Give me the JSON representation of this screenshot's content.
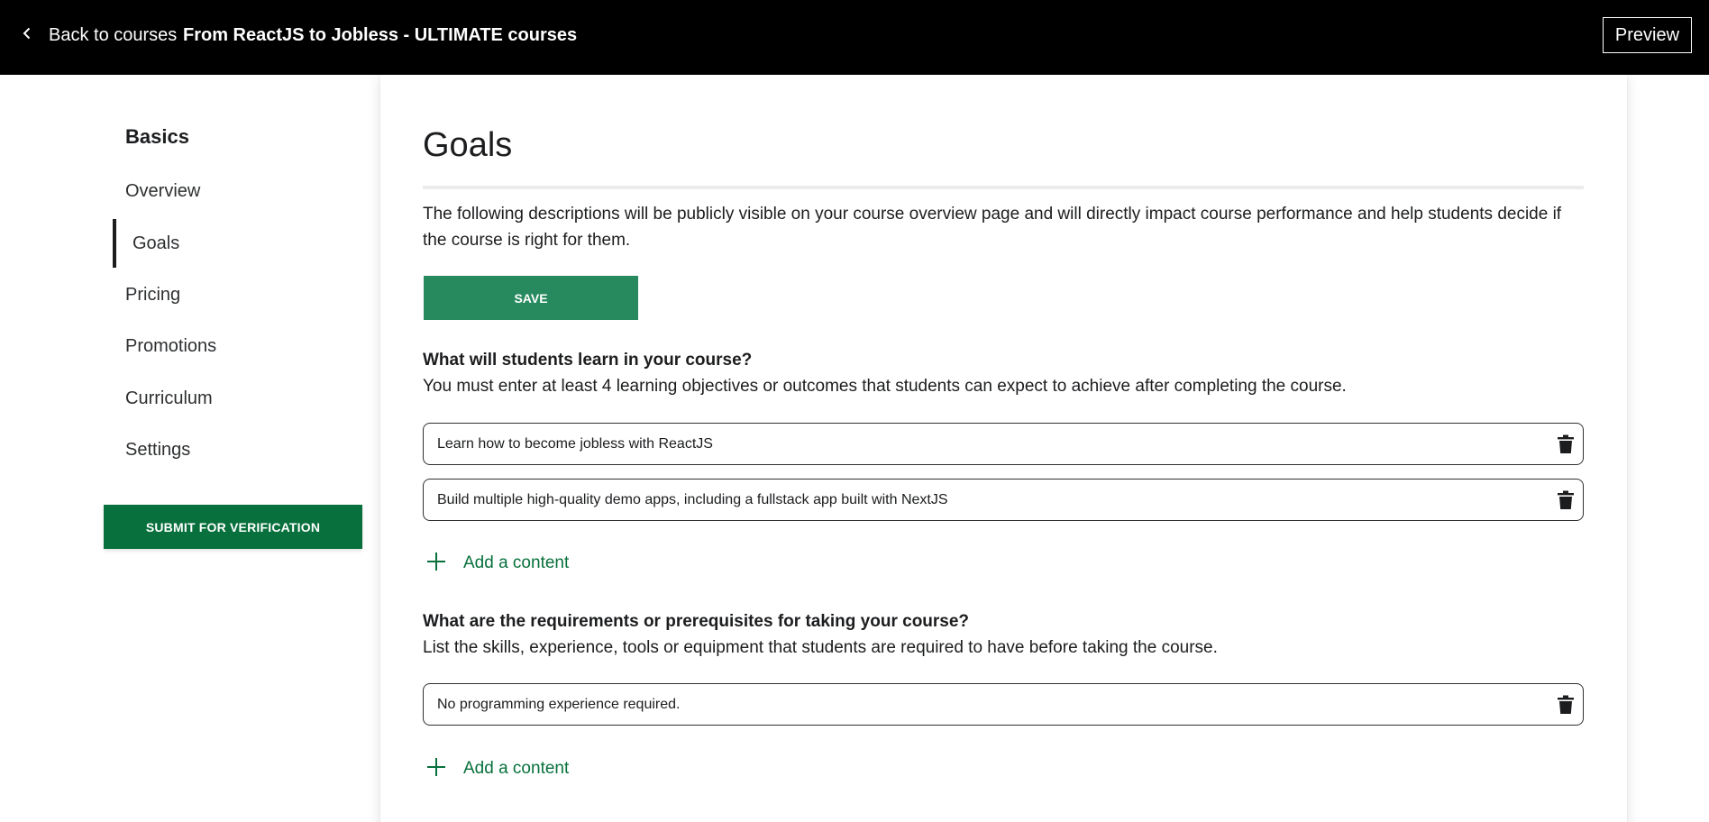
{
  "header": {
    "back_label": "Back to courses",
    "course_title": "From ReactJS to Jobless - ULTIMATE courses",
    "preview_label": "Preview"
  },
  "sidebar": {
    "heading": "Basics",
    "items": [
      {
        "label": "Overview",
        "active": false
      },
      {
        "label": "Goals",
        "active": true
      },
      {
        "label": "Pricing",
        "active": false
      },
      {
        "label": "Promotions",
        "active": false
      },
      {
        "label": "Curriculum",
        "active": false
      },
      {
        "label": "Settings",
        "active": false
      }
    ],
    "submit_label": "SUBMIT FOR VERIFICATION"
  },
  "main": {
    "title": "Goals",
    "intro": "The following descriptions will be publicly visible on your course overview page and will directly impact course performance and help students decide if the course is right for them.",
    "save_label": "SAVE",
    "sections": [
      {
        "title": "What will students learn in your course?",
        "description": "You must enter at least 4 learning objectives or outcomes that students can expect to achieve after completing the course.",
        "entries": [
          "Learn how to become jobless with ReactJS",
          "Build multiple high-quality demo apps, including a fullstack app built with NextJS"
        ],
        "add_label": "Add a content"
      },
      {
        "title": "What are the requirements or prerequisites for taking your course?",
        "description": "List the skills, experience, tools or equipment that students are required to have before taking the course.",
        "entries": [
          "No programming experience required."
        ],
        "add_label": "Add a content"
      }
    ]
  },
  "colors": {
    "topbar": "#000000",
    "brand_green": "#07703c",
    "save_green": "#278a5e",
    "text": "#1c1d1f"
  },
  "icons": {
    "back": "chevron-left-icon",
    "delete": "trash-icon",
    "add": "plus-icon"
  }
}
